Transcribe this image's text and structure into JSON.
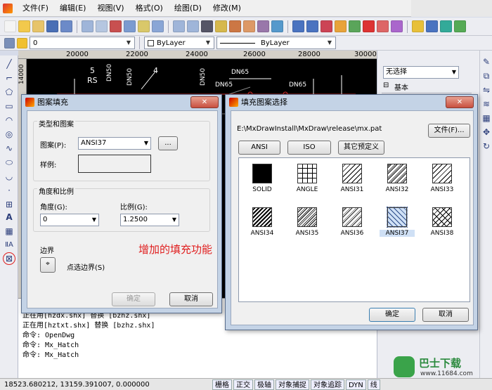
{
  "menu": [
    "文件(F)",
    "编辑(E)",
    "视图(V)",
    "格式(O)",
    "绘图(D)",
    "修改(M)"
  ],
  "layerbar": {
    "layer_value": "0",
    "color_value": "ByLayer",
    "linetype_value": "ByLayer"
  },
  "ruler": {
    "top": [
      "20000",
      "22000",
      "24000",
      "26000",
      "28000",
      "30000"
    ],
    "left": "14000"
  },
  "drawing_labels": [
    "5",
    "RS",
    "DN50",
    "DN50",
    "4",
    "DN50",
    "DN65",
    "DN65",
    "DN65"
  ],
  "rightpanel": {
    "select_value": "无选择",
    "section": "基本",
    "toggle": "⊟"
  },
  "hatch_dialog": {
    "title": "图案填充",
    "group_type_title": "类型和图案",
    "pattern_label": "图案(P):",
    "pattern_value": "ANSI37",
    "browse_label": "...",
    "sample_label": "样例:",
    "group_angle_title": "角度和比例",
    "angle_label": "角度(G):",
    "angle_value": "0",
    "scale_label": "比例(G):",
    "scale_value": "1.2500",
    "boundary_title": "边界",
    "pick_label": "点选边界(S)",
    "annotation": "增加的填充功能",
    "ok_label": "确定",
    "cancel_label": "取消"
  },
  "pattern_dialog": {
    "title": "填充图案选择",
    "path": "E:\\MxDrawInstall\\MxDraw\\release\\mx.pat",
    "file_button": "文件(F)...",
    "tabs": [
      "ANSI",
      "ISO",
      "其它预定义"
    ],
    "patterns": [
      {
        "name": "SOLID",
        "style": "solid"
      },
      {
        "name": "ANGLE",
        "style": "angle"
      },
      {
        "name": "ANSI31",
        "style": "ansi31"
      },
      {
        "name": "ANSI32",
        "style": "ansi32"
      },
      {
        "name": "ANSI33",
        "style": "ansi33"
      },
      {
        "name": "ANSI34",
        "style": "ansi34"
      },
      {
        "name": "ANSI35",
        "style": "ansi35"
      },
      {
        "name": "ANSI36",
        "style": "ansi36"
      },
      {
        "name": "ANSI37",
        "style": "ansi37",
        "selected": true
      },
      {
        "name": "ANSI38",
        "style": "ansi38"
      }
    ],
    "ok_label": "确定",
    "cancel_label": "取消"
  },
  "command_lines": [
    "正在用[hzdx.shx] 替换 [bzhz.shx]",
    "正在用[hztxt.shx] 替换 [bzhz.shx]",
    "命令: OpenDwg",
    "命令: Mx_Hatch",
    "命令: Mx_Hatch"
  ],
  "status": {
    "coords": "18523.680212, 13159.391007, 0.000000",
    "buttons": [
      "栅格",
      "正交",
      "极轴",
      "对象捕捉",
      "对象追踪",
      "DYN",
      "线"
    ]
  },
  "watermark": {
    "name": "巴士下载",
    "url": "www.11684.com"
  },
  "colors": {
    "dialog_frame": "#c4d3e6",
    "annotation_red": "#e02020",
    "canvas": "#000000"
  }
}
